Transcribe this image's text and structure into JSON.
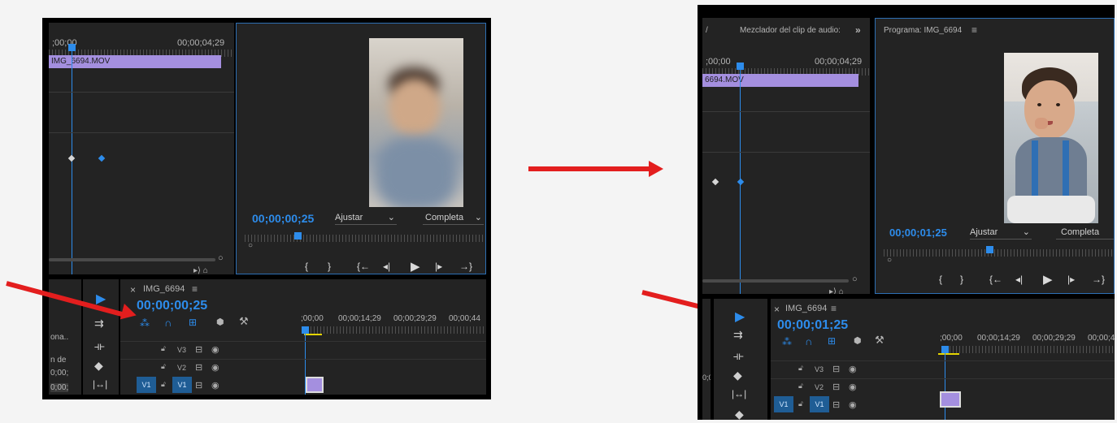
{
  "left": {
    "ruler_start": ";00;00",
    "ruler_end": "00;00;04;29",
    "clip_name": "IMG_6694.MOV",
    "program_timecode": "00;00;00;25",
    "zoom_dropdown": "Ajustar",
    "quality_dropdown": "Completa",
    "sequence_name": "IMG_6694",
    "sequence_timecode": "00;00;00;25",
    "timeline_ticks": [
      ";00;00",
      "00;00;14;29",
      "00;00;29;29",
      "00;00;44"
    ],
    "tracks": [
      "V3",
      "V2",
      "V1"
    ],
    "side_labels": [
      "ona..",
      "n de",
      "0;00;",
      "0;00;"
    ],
    "source_patch": "V1"
  },
  "right": {
    "panel_tab_audio": "Mezclador del clip de audio:",
    "panel_tab_program": "Programa: IMG_6694",
    "ruler_start": ";00;00",
    "ruler_end": "00;00;04;29",
    "clip_name": "6694.MOV",
    "program_timecode": "00;00;01;25",
    "zoom_dropdown": "Ajustar",
    "quality_dropdown": "Completa",
    "sequence_name": "IMG_6694",
    "sequence_timecode": "00;00;01;25",
    "timeline_ticks": [
      ";00;00",
      "00;00;14;29",
      "00;00;29;29",
      "00;00;4"
    ],
    "tracks": [
      "V3",
      "V2",
      "V1"
    ],
    "side_labels": [
      "0;00;"
    ],
    "source_patch": "V1"
  },
  "colors": {
    "accent": "#2d8ceb",
    "clip": "#a48fdf",
    "arrow": "#e31e1e",
    "panel": "#232323"
  },
  "icons": {
    "close": "×",
    "menu": "≡",
    "overflow": "»",
    "chevron": "⌄"
  }
}
